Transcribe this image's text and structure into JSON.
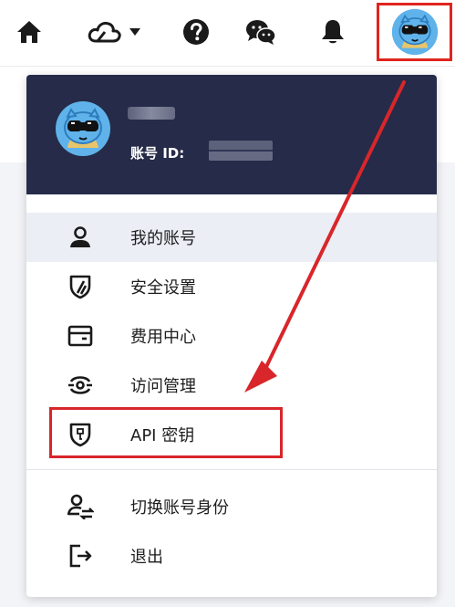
{
  "topbar": {
    "icons": [
      "home-icon",
      "cloud-icon",
      "help-icon",
      "wechat-icon",
      "bell-icon",
      "avatar"
    ]
  },
  "profile": {
    "account_id_label": "账号 ID:"
  },
  "menu": {
    "items": [
      {
        "label": "我的账号",
        "icon": "user-icon"
      },
      {
        "label": "安全设置",
        "icon": "shield-icon"
      },
      {
        "label": "费用中心",
        "icon": "wallet-icon"
      },
      {
        "label": "访问管理",
        "icon": "access-icon"
      },
      {
        "label": "API 密钥",
        "icon": "key-shield-icon"
      },
      {
        "label": "切换账号身份",
        "icon": "switch-user-icon"
      },
      {
        "label": "退出",
        "icon": "logout-icon"
      }
    ]
  },
  "colors": {
    "header_bg": "#252b48",
    "highlight_red": "#d8262a",
    "active_row": "#ebeef4"
  }
}
